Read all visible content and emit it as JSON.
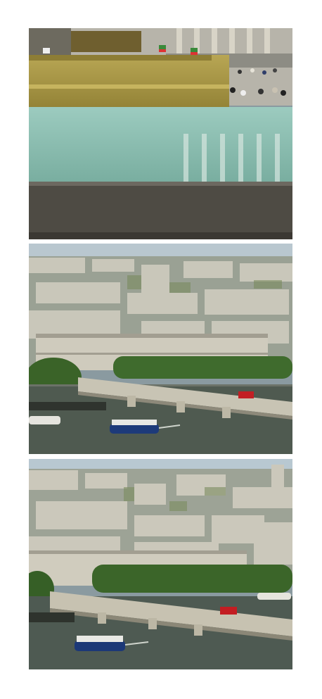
{
  "layout": {
    "background": "#ffffff",
    "panel_count": 3
  },
  "panels": [
    {
      "id": "fountain",
      "description_tag": "fountain-basin-with-reflected-columns",
      "palette": {
        "sky": "#c9ccc7",
        "building": "#a9a395",
        "fountain_stone": "#a7953f",
        "water": "#8fbfb3",
        "ledge": "#4f4c45"
      }
    },
    {
      "id": "river-view-wide",
      "description_tag": "aerial-city-river-bridge",
      "palette": {
        "sky": "#b9c7cf",
        "city": "#a8aea6",
        "trees": "#3f6b2d",
        "river": "#4f5a50",
        "bridge": "#c8c4b4",
        "bus": "#c21f24"
      }
    },
    {
      "id": "river-view-close",
      "description_tag": "aerial-city-river-bridge-closer",
      "palette": {
        "sky": "#b8c8d1",
        "city": "#a7aca3",
        "trees": "#3b6529",
        "river": "#4e5a52",
        "bridge": "#c7c2b1",
        "bus": "#c31d22"
      }
    }
  ]
}
